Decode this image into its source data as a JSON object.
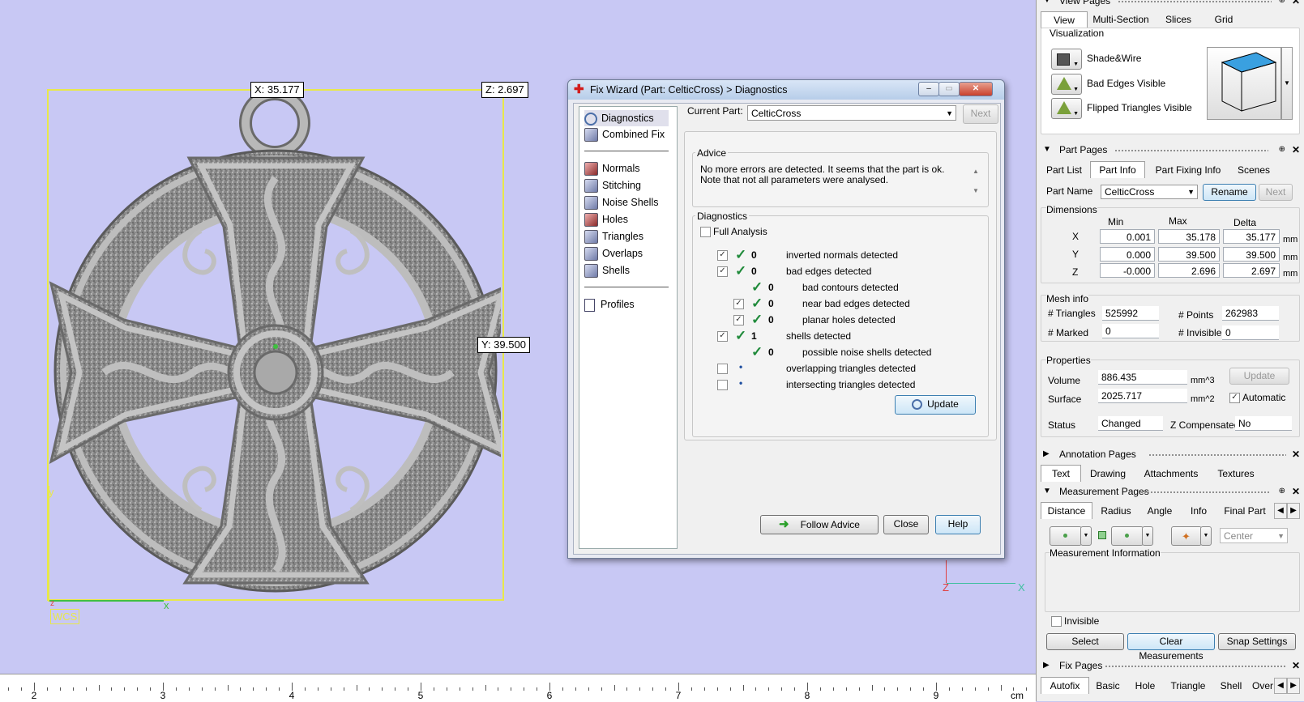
{
  "viewport": {
    "coord_x": "X: 35.177",
    "coord_z": "Z: 2.697",
    "coord_y": "Y: 39.500",
    "wcs_label": "WCS",
    "axis_y": "y",
    "axis_x": "x",
    "axis_z": "z",
    "axis2_z": "Z",
    "axis2_x": "X"
  },
  "ruler": {
    "labels": [
      "2",
      "3",
      "4",
      "5",
      "6",
      "7",
      "8",
      "9"
    ],
    "unit": "cm"
  },
  "dialog": {
    "title": "Fix Wizard (Part: CelticCross) > Diagnostics",
    "nav": {
      "diagnostics": "Diagnostics",
      "combined_fix": "Combined Fix",
      "normals": "Normals",
      "stitching": "Stitching",
      "noise_shells": "Noise Shells",
      "holes": "Holes",
      "triangles": "Triangles",
      "overlaps": "Overlaps",
      "shells": "Shells",
      "profiles": "Profiles"
    },
    "current_part_label": "Current Part:",
    "current_part_value": "CelticCross",
    "next_label": "Next",
    "advice_title": "Advice",
    "advice_text": "No more errors are detected. It seems that the part is ok. Note that not all parameters were analysed.",
    "diagnostics_title": "Diagnostics",
    "full_analysis": "Full Analysis",
    "rows": [
      {
        "count": "0",
        "label": "inverted normals detected"
      },
      {
        "count": "0",
        "label": "bad edges detected"
      },
      {
        "count": "0",
        "label": "bad contours detected"
      },
      {
        "count": "0",
        "label": "near bad edges detected"
      },
      {
        "count": "0",
        "label": "planar holes detected"
      },
      {
        "count": "1",
        "label": "shells detected"
      },
      {
        "count": "0",
        "label": "possible noise shells detected"
      },
      {
        "count": "",
        "label": "overlapping triangles detected"
      },
      {
        "count": "",
        "label": "intersecting triangles detected"
      }
    ],
    "update_label": "Update",
    "follow_advice_label": "Follow Advice",
    "close_label": "Close",
    "help_label": "Help"
  },
  "panel": {
    "view_pages": {
      "title": "View Pages",
      "tabs": [
        "View",
        "Multi-Section",
        "Slices",
        "Grid"
      ],
      "visualization": "Visualization",
      "shade_wire": "Shade&Wire",
      "bad_edges": "Bad Edges Visible",
      "flipped": "Flipped Triangles Visible"
    },
    "part_pages": {
      "title": "Part Pages",
      "tabs": [
        "Part List",
        "Part Info",
        "Part Fixing Info",
        "Scenes"
      ],
      "part_name_label": "Part Name",
      "part_name_value": "CelticCross",
      "rename": "Rename",
      "next": "Next",
      "dimensions": "Dimensions",
      "min": "Min",
      "max": "Max",
      "delta": "Delta",
      "x": "X",
      "y": "Y",
      "z": "Z",
      "x_min": "0.001",
      "x_max": "35.178",
      "x_delta": "35.177",
      "y_min": "0.000",
      "y_max": "39.500",
      "y_delta": "39.500",
      "z_min": "-0.000",
      "z_max": "2.696",
      "z_delta": "2.697",
      "mm": "mm",
      "mesh_info": "Mesh info",
      "triangles_label": "# Triangles",
      "triangles": "525992",
      "points_label": "# Points",
      "points": "262983",
      "marked_label": "# Marked",
      "marked": "0",
      "invisible_label": "# Invisible",
      "invisible": "0",
      "properties": "Properties",
      "volume_label": "Volume",
      "volume": "886.435",
      "volume_unit": "mm^3",
      "surface_label": "Surface",
      "surface": "2025.717",
      "surface_unit": "mm^2",
      "update": "Update",
      "automatic": "Automatic",
      "status_label": "Status",
      "status": "Changed",
      "zcomp_label": "Z Compensated",
      "zcomp": "No"
    },
    "annotation_pages": {
      "title": "Annotation Pages",
      "tabs": [
        "Text",
        "Drawing",
        "Attachments",
        "Textures"
      ]
    },
    "measurement_pages": {
      "title": "Measurement Pages",
      "tabs": [
        "Distance",
        "Radius",
        "Angle",
        "Info",
        "Final Part"
      ],
      "center": "Center",
      "info_title": "Measurement Information",
      "invisible": "Invisible",
      "select": "Select",
      "clear": "Clear Measurements",
      "snap": "Snap Settings"
    },
    "fix_pages": {
      "title": "Fix Pages",
      "tabs": [
        "Autofix",
        "Basic",
        "Hole",
        "Triangle",
        "Shell",
        "Over"
      ]
    }
  },
  "colors": {
    "viewport_bg": "#c8c8f4",
    "bbox": "#e8e84a",
    "check": "#1f8a3a",
    "accent": "#3aa0e0"
  }
}
